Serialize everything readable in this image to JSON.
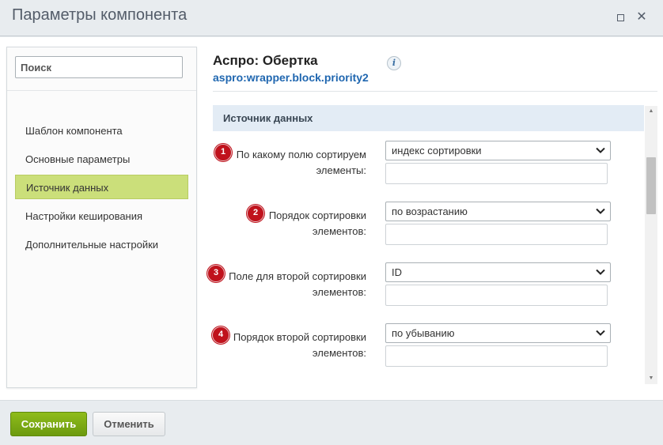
{
  "window": {
    "title": "Параметры компонента"
  },
  "sidebar": {
    "search_placeholder": "Поиск",
    "items": [
      {
        "label": "Шаблон компонента"
      },
      {
        "label": "Основные параметры"
      },
      {
        "label": "Источник данных",
        "active": true
      },
      {
        "label": "Настройки кеширования"
      },
      {
        "label": "Дополнительные настройки"
      }
    ]
  },
  "component": {
    "title": "Аспро: Обертка",
    "code": "aspro:wrapper.block.priority2",
    "info_icon_glyph": "i"
  },
  "section": {
    "title": "Источник данных"
  },
  "fields": [
    {
      "badge": "1",
      "label_line1": "По какому полю сортируем",
      "label_line2": "элементы:",
      "value": "индекс сортировки",
      "text_value": ""
    },
    {
      "badge": "2",
      "label_line1": "Порядок сортировки",
      "label_line2": "элементов:",
      "value": "по возрастанию",
      "text_value": ""
    },
    {
      "badge": "3",
      "label_line1": "Поле для второй сортировки",
      "label_line2": "элементов:",
      "value": "ID",
      "text_value": ""
    },
    {
      "badge": "4",
      "label_line1": "Порядок второй сортировки",
      "label_line2": "элементов:",
      "value": "по убыванию",
      "text_value": ""
    }
  ],
  "footer": {
    "save_label": "Сохранить",
    "cancel_label": "Отменить"
  },
  "colors": {
    "accent_green": "#7aa815",
    "badge_red": "#c0121c",
    "link_blue": "#2067b0",
    "active_nav": "#cbdf7a"
  },
  "icons": {
    "maximize": "maximize-icon",
    "close": "close-icon",
    "info": "info-icon",
    "dropdown": "chevron-down-icon"
  }
}
